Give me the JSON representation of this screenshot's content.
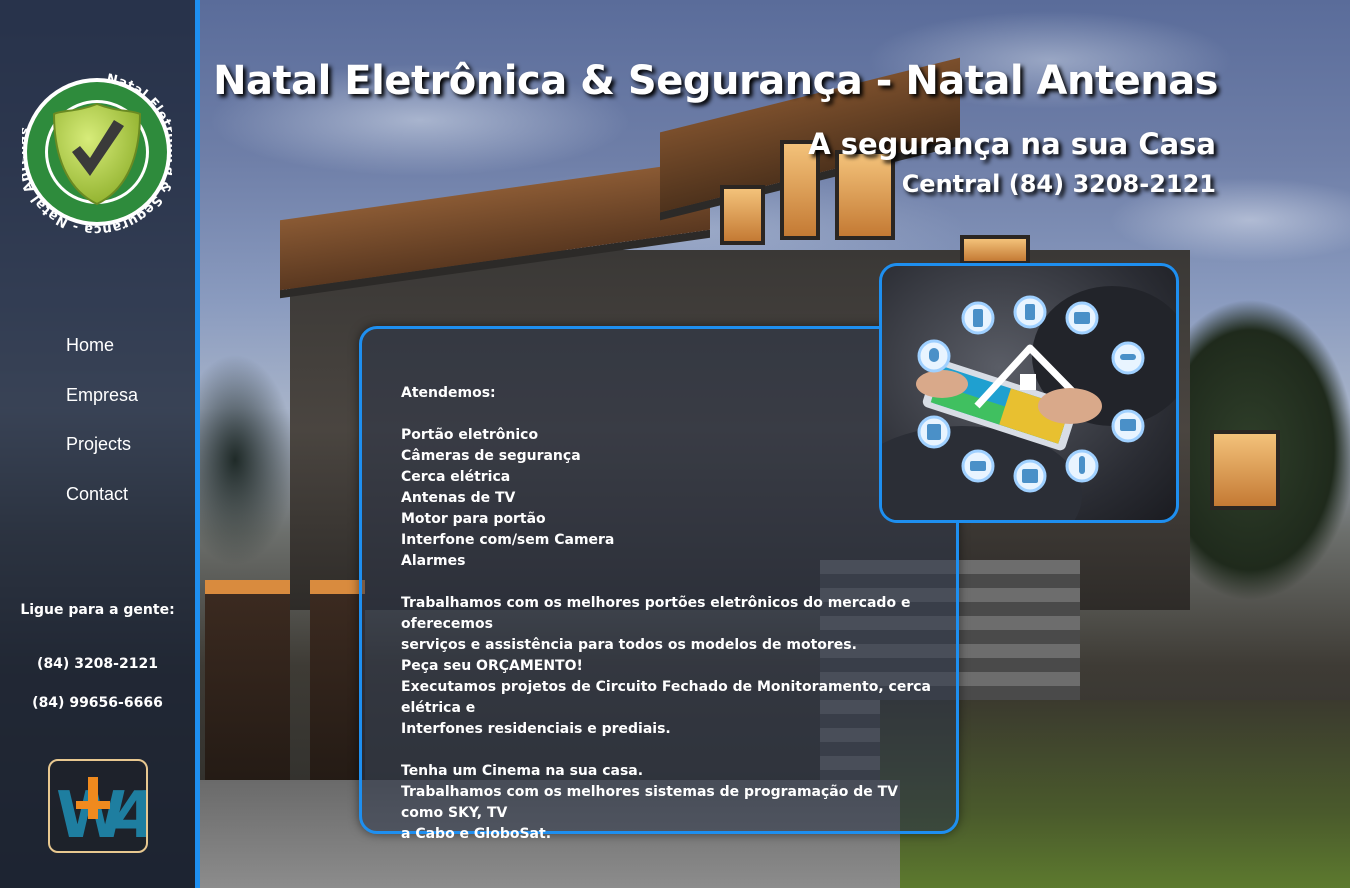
{
  "header": {
    "title": "Natal Eletrônica & Segurança - Natal Antenas",
    "subtitle": "A segurança na sua Casa",
    "central": "Central (84) 3208-2121"
  },
  "logo": {
    "ring_text": "Natal Eletrônica & Segurança - Natal Antenas",
    "icon": "checkmark-shield-icon"
  },
  "nav": {
    "items": [
      {
        "label": "Home"
      },
      {
        "label": "Empresa"
      },
      {
        "label": "Projects"
      },
      {
        "label": "Contact"
      }
    ]
  },
  "contact": {
    "title": "Ligue para a gente:",
    "phone1": "(84) 3208-2121",
    "phone2": "(84) 99656-6666"
  },
  "badge": {
    "text": "W4Y"
  },
  "content": {
    "heading": "Atendemos:",
    "services": [
      "Portão eletrônico",
      "Câmeras de segurança",
      "Cerca elétrica",
      "Antenas de TV",
      "Motor para portão",
      "Interfone com/sem Camera",
      "Alarmes"
    ],
    "para1_l1": "Trabalhamos com os melhores portões eletrônicos do mercado e oferecemos",
    "para1_l2": "serviços e assistência para todos os modelos de motores.",
    "para2": "Peça seu ORÇAMENTO!",
    "para3_l1": "Executamos projetos de Circuito Fechado de Monitoramento, cerca elétrica e",
    "para3_l2": "Interfones residenciais e prediais.",
    "para4": "Tenha um Cinema na sua casa.",
    "para5_l1": "Trabalhamos com os melhores sistemas de programação de TV como SKY, TV",
    "para5_l2": "a Cabo e GloboSat."
  },
  "colors": {
    "accent": "#1e8ff0",
    "sidebar": "#1a2234",
    "logo_green": "#2e8b3c",
    "logo_lime": "#b8d84a"
  }
}
